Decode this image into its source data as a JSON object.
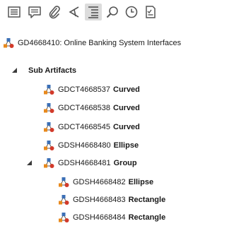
{
  "toolbar": {
    "buttons": [
      {
        "name": "list-view-icon",
        "active": false
      },
      {
        "name": "comment-icon",
        "active": false
      },
      {
        "name": "attachment-icon",
        "active": false
      },
      {
        "name": "share-icon",
        "active": false
      },
      {
        "name": "outline-icon",
        "active": true
      },
      {
        "name": "search-icon",
        "active": false
      },
      {
        "name": "history-icon",
        "active": false
      },
      {
        "name": "review-checklist-icon",
        "active": false
      }
    ]
  },
  "root": {
    "label": "GD4668410: Online Banking System Interfaces"
  },
  "sub_artifacts": {
    "title": "Sub Artifacts",
    "items": [
      {
        "id": "GDCT4668537",
        "type": "Curved"
      },
      {
        "id": "GDCT4668538",
        "type": "Curved"
      },
      {
        "id": "GDCT4668545",
        "type": "Curved"
      },
      {
        "id": "GDSH4668480",
        "type": "Ellipse"
      },
      {
        "id": "GDSH4668481",
        "type": "Group",
        "children": [
          {
            "id": "GDSH4668482",
            "type": "Ellipse"
          },
          {
            "id": "GDSH4668483",
            "type": "Rectangle"
          },
          {
            "id": "GDSH4668484",
            "type": "Rectangle"
          }
        ]
      }
    ]
  },
  "colors": {
    "icon_blue": "#3b6fb6",
    "icon_orange": "#e8891c",
    "icon_red": "#d23a2a",
    "icon_gray": "#5a5a5a"
  }
}
